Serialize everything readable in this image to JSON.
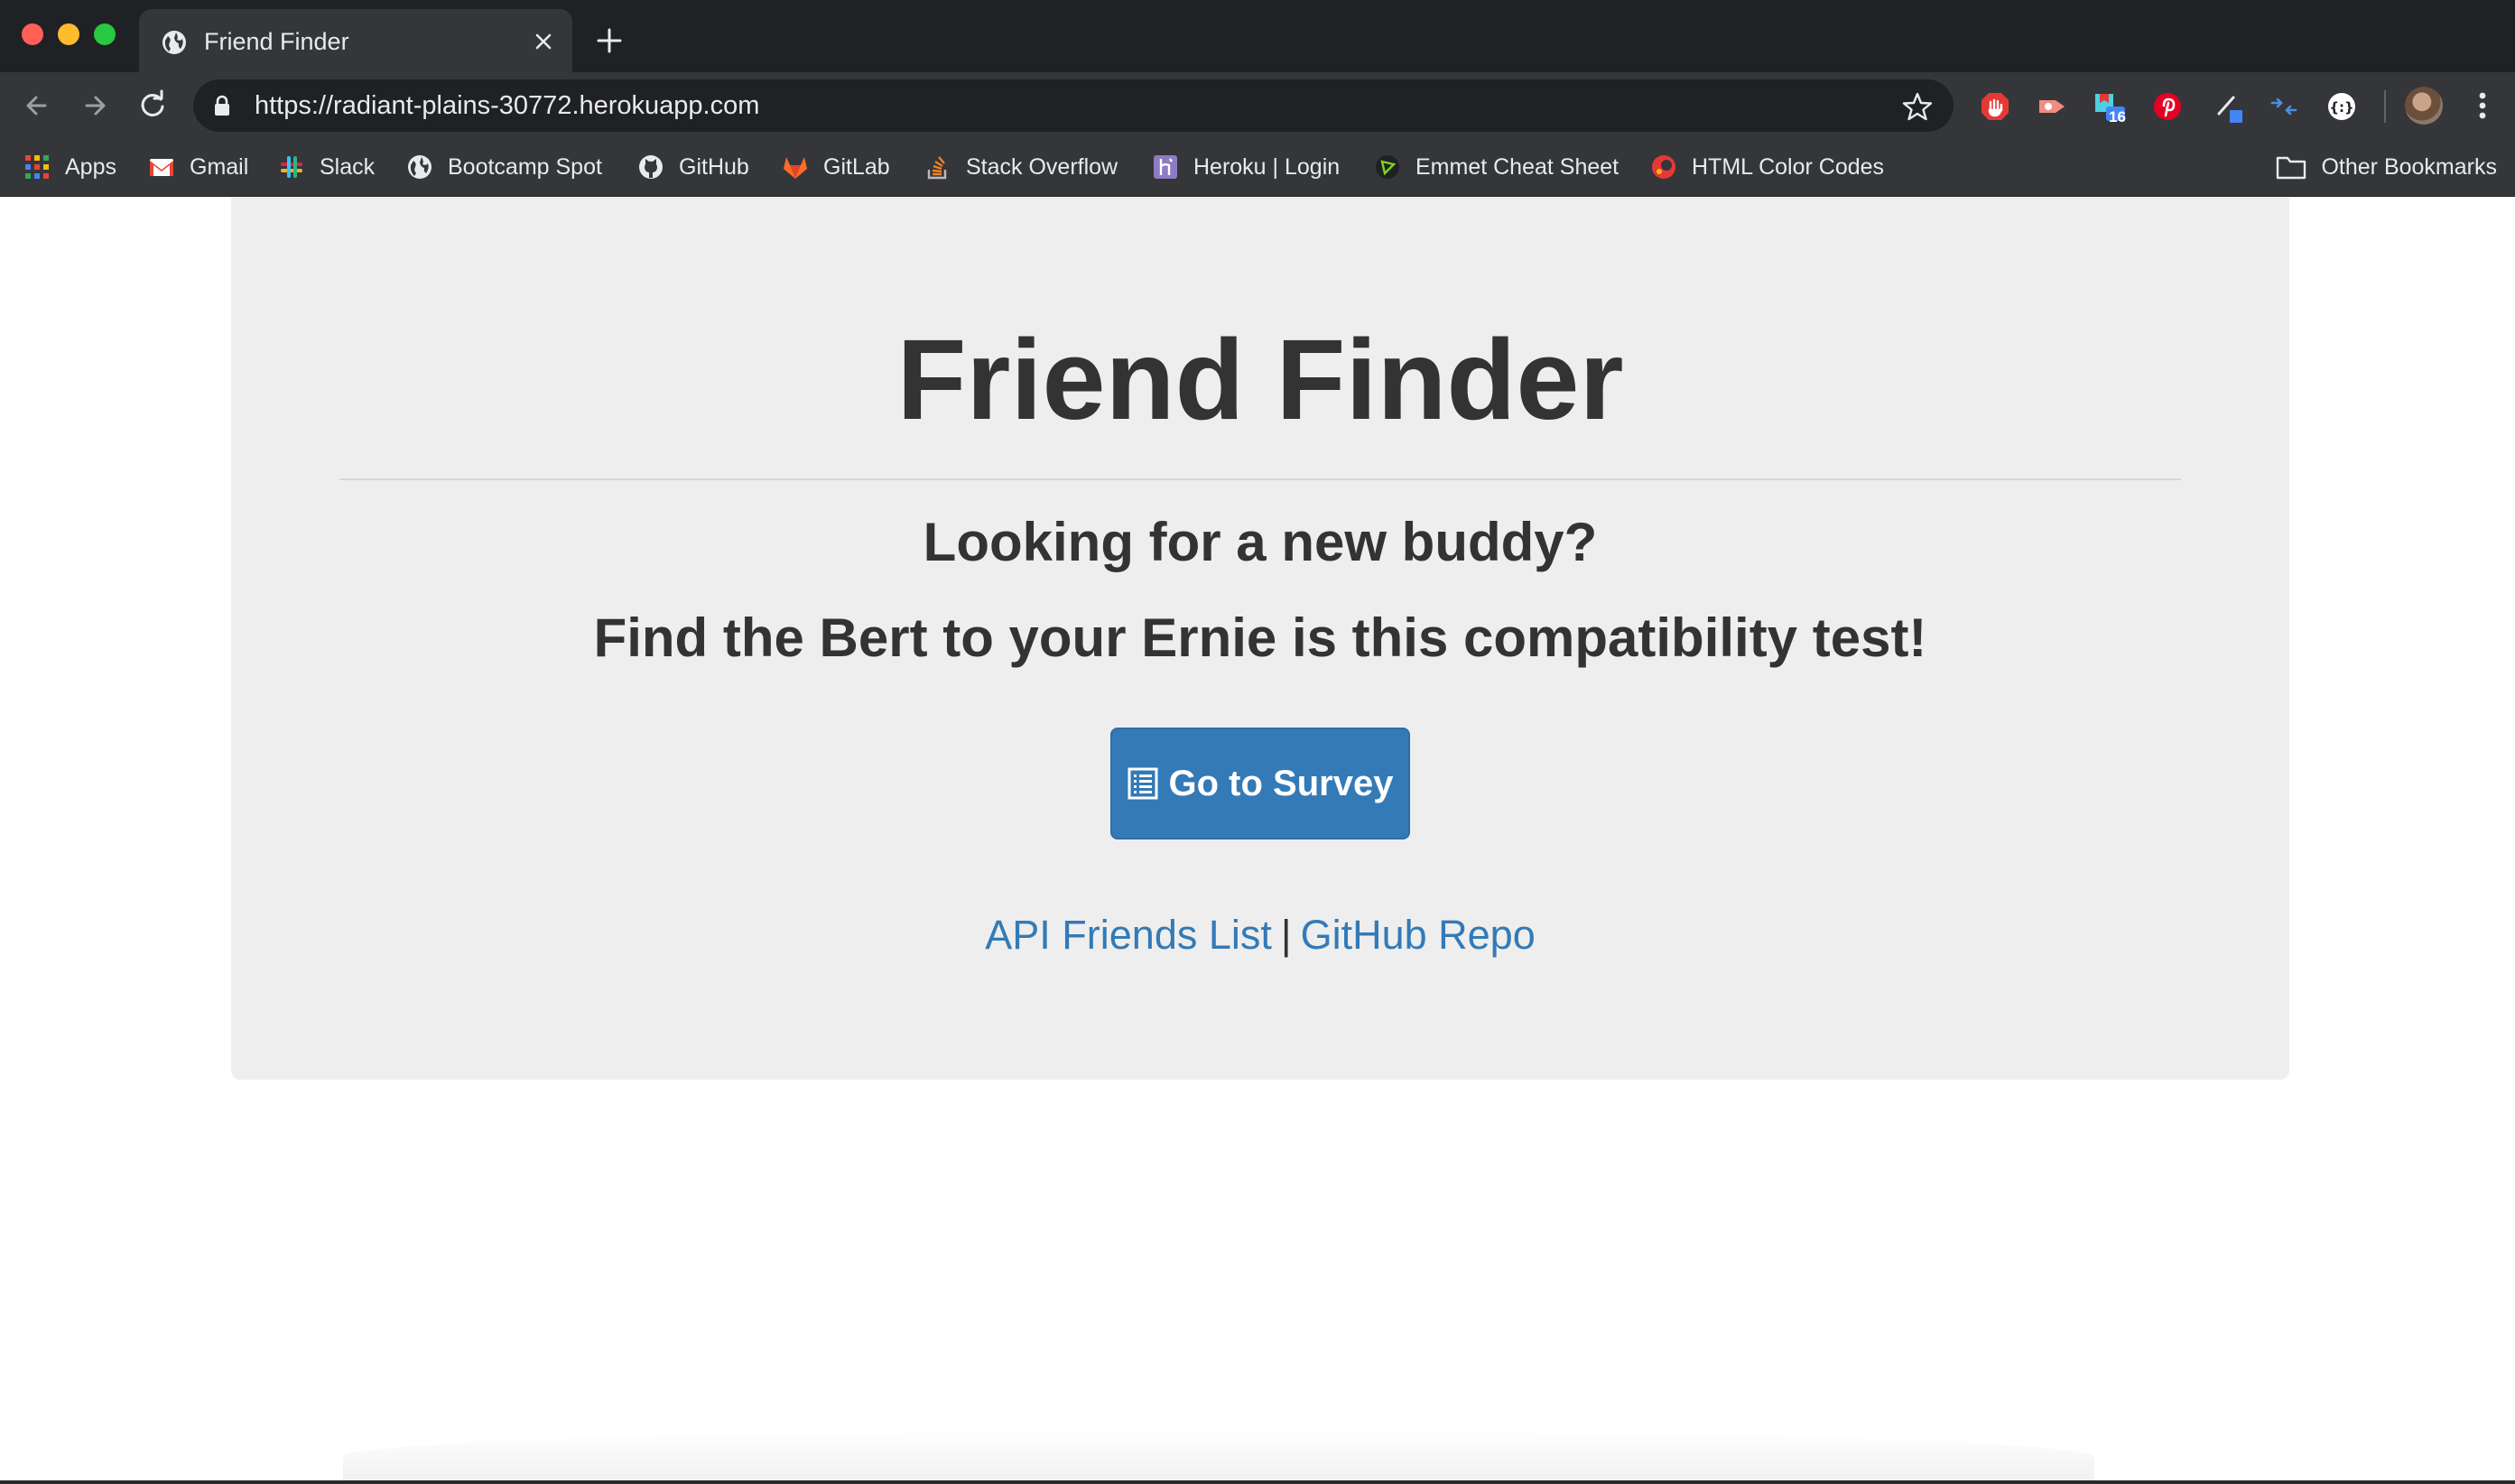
{
  "window": {
    "tab_title": "Friend Finder",
    "tab_favicon": "globe-icon",
    "close_icon": "close-icon",
    "new_tab_icon": "plus-icon"
  },
  "toolbar": {
    "url": "https://radiant-plains-30772.herokuapp.com",
    "extension_badge": "16"
  },
  "bookmarks": {
    "items": [
      {
        "label": "Apps",
        "icon": "apps-grid-icon"
      },
      {
        "label": "Gmail",
        "icon": "gmail-icon"
      },
      {
        "label": "Slack",
        "icon": "slack-icon"
      },
      {
        "label": "Bootcamp Spot",
        "icon": "globe-icon"
      },
      {
        "label": "GitHub",
        "icon": "github-icon"
      },
      {
        "label": "GitLab",
        "icon": "gitlab-icon"
      },
      {
        "label": "Stack Overflow",
        "icon": "stack-overflow-icon"
      },
      {
        "label": "Heroku | Login",
        "icon": "heroku-icon"
      },
      {
        "label": "Emmet Cheat Sheet",
        "icon": "emmet-icon"
      },
      {
        "label": "HTML Color Codes",
        "icon": "html-color-codes-icon"
      }
    ],
    "other": "Other Bookmarks"
  },
  "page": {
    "title": "Friend Finder",
    "subtitle_1": "Looking for a new buddy?",
    "subtitle_2": "Find the Bert to your Ernie is this compatibility test!",
    "survey_button": "Go to Survey",
    "link_api": "API Friends List",
    "link_separator": "|",
    "link_github": "GitHub Repo"
  },
  "colors": {
    "primary": "#337ab7",
    "jumbotron_bg": "#eeeeee",
    "text": "#333333",
    "chrome_dark": "#202124",
    "chrome_toolbar": "#35363a"
  }
}
